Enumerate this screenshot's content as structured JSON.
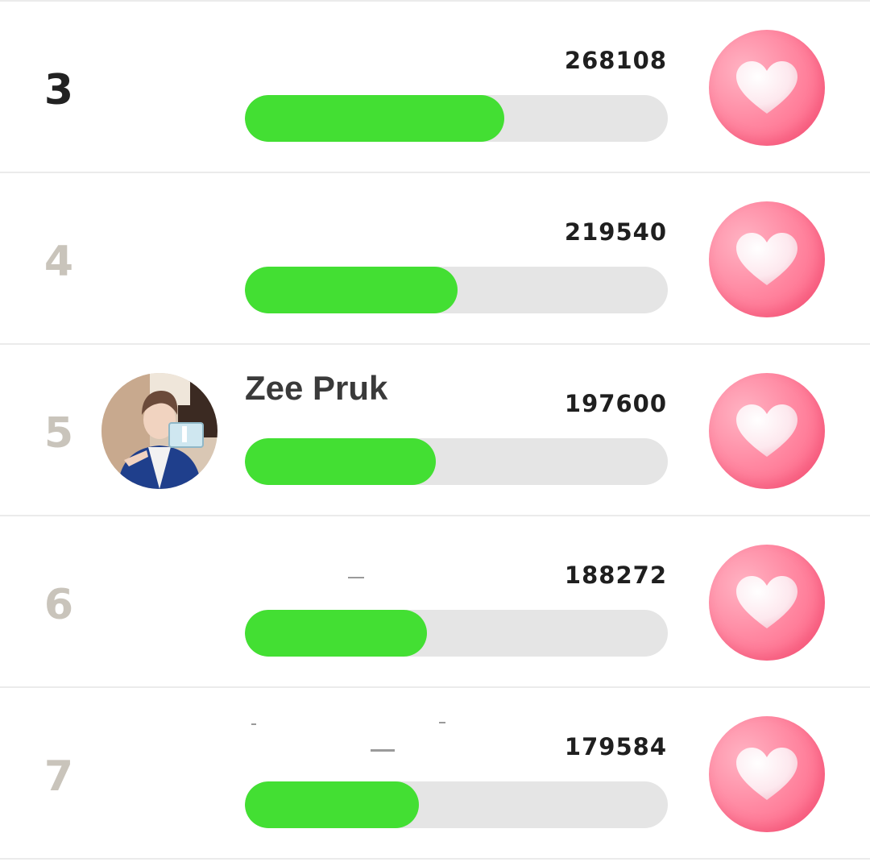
{
  "rows": [
    {
      "rank": "3",
      "name": "",
      "score": "268108",
      "progress_fraction": 0.613,
      "rank_color": "#222222"
    },
    {
      "rank": "4",
      "name": "",
      "score": "219540",
      "progress_fraction": 0.503,
      "rank_color": "#c9c4bb"
    },
    {
      "rank": "5",
      "name": "Zee Pruk",
      "score": "197600",
      "progress_fraction": 0.451,
      "rank_color": "#c9c4bb"
    },
    {
      "rank": "6",
      "name": "",
      "score": "188272",
      "progress_fraction": 0.43,
      "rank_color": "#c9c4bb"
    },
    {
      "rank": "7",
      "name": "",
      "score": "179584",
      "progress_fraction": 0.411,
      "rank_color": "#c9c4bb"
    }
  ],
  "colors": {
    "progress_fill": "#43df33",
    "progress_track": "#e5e5e5",
    "vote_button": "#ff7d99"
  },
  "icons": {
    "vote": "heart-icon"
  }
}
